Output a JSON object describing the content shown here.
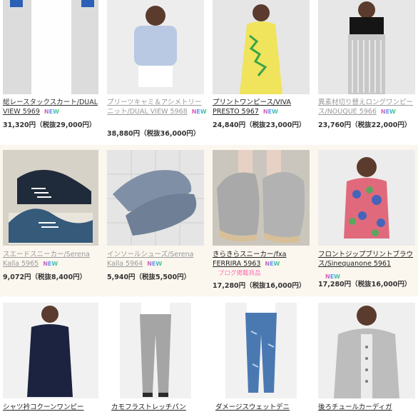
{
  "products": [
    {
      "title": "総レースタックスカート/DUAL VIEW 5969",
      "new": "NEW",
      "price": "31,320円（税抜29,000円）",
      "img": {
        "bg": "#d9d9d9",
        "accent": "#ffffff",
        "label": "skirt"
      }
    },
    {
      "title": "プリーツキャミ＆アシメトリーニット/DUAL VIEW 5968",
      "new": "NEW",
      "price": "38,880円（税抜36,000円）",
      "img": {
        "bg": "#e8e8e8",
        "accent": "#b9c9e3",
        "label": "knit"
      }
    },
    {
      "title": "プリントワンピース/VIVA PRESTO 5967",
      "new": "NEW",
      "price": "24,840円（税抜23,000円）",
      "img": {
        "bg": "#e3e3e3",
        "accent": "#efe45c",
        "label": "dress"
      }
    },
    {
      "title": "異素材切り替えロングワンピース/NOUQUE 5966",
      "new": "NEW",
      "price": "23,760円（税抜22,000円）",
      "img": {
        "bg": "#e6e6e6",
        "accent": "#151515",
        "label": "longdress"
      }
    },
    {
      "title": "スエードスニーカー/Serena Kalla 5965",
      "new": "NEW",
      "price": "9,072円（税抜8,400円）",
      "img": {
        "bg": "#d7d2c8",
        "accent": "#355a7a",
        "label": "sneakers"
      }
    },
    {
      "title": "インソールシューズ/Serena Kalla 5964",
      "new": "NEW",
      "price": "5,940円（税抜5,500円）",
      "img": {
        "bg": "#dedede",
        "accent": "#7f8fa6",
        "label": "shoes"
      }
    },
    {
      "title": "きらきらスニーカー/fxa FERRIRA 5963",
      "new": "NEW",
      "note": "ブログ掲載商品",
      "price": "17,280円（税抜16,000円）",
      "img": {
        "bg": "#cbc6bd",
        "accent": "#a9a9a9",
        "label": "glitter"
      }
    },
    {
      "title": "フロントジップブリントブラウス/Sinequanone 5961",
      "new": "NEW",
      "price": "17,280円（税抜16,000円）",
      "img": {
        "bg": "#ececec",
        "accent": "#e06a7c",
        "label": "blouse"
      }
    },
    {
      "title": "シャツ衿コクーンワンピー",
      "img": {
        "bg": "#eeeeee",
        "accent": "#1b2340",
        "label": "navydress"
      }
    },
    {
      "title": "カモフラストレッチパン",
      "img": {
        "bg": "#eeeeee",
        "accent": "#a5a5a5",
        "label": "pants"
      }
    },
    {
      "title": "ダメージスウェットデニ",
      "img": {
        "bg": "#eeeeee",
        "accent": "#4a79b2",
        "label": "denim"
      }
    },
    {
      "title": "後ろチュールカーディガ",
      "img": {
        "bg": "#eeeeee",
        "accent": "#bdbdbd",
        "label": "cardigan"
      }
    }
  ]
}
